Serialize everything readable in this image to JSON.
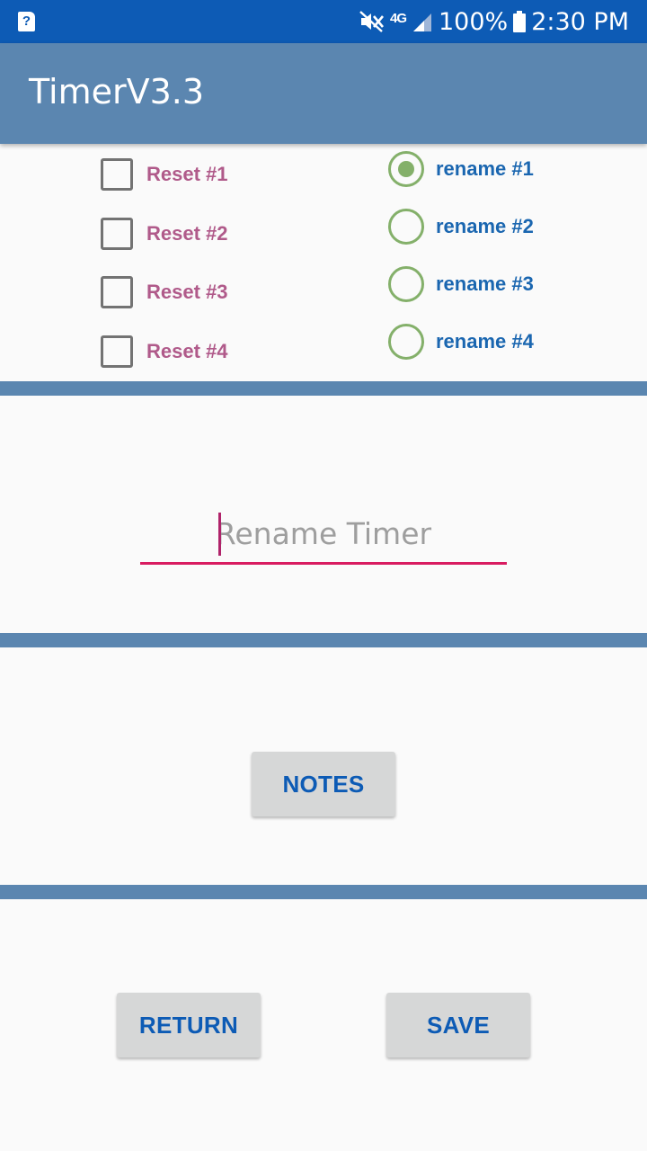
{
  "status_bar": {
    "network": "4G",
    "battery": "100%",
    "time": "2:30 PM"
  },
  "app_bar": {
    "title": "TimerV3.3"
  },
  "reset_checkboxes": [
    {
      "label": "Reset #1",
      "checked": false
    },
    {
      "label": "Reset #2",
      "checked": false
    },
    {
      "label": "Reset #3",
      "checked": false
    },
    {
      "label": "Reset #4",
      "checked": false
    }
  ],
  "rename_radios": [
    {
      "label": "rename #1",
      "selected": true
    },
    {
      "label": "rename #2",
      "selected": false
    },
    {
      "label": "rename #3",
      "selected": false
    },
    {
      "label": "rename #4",
      "selected": false
    }
  ],
  "rename_field": {
    "value": "",
    "placeholder": "Rename Timer"
  },
  "buttons": {
    "notes": "NOTES",
    "return": "RETURN",
    "save": "SAVE"
  },
  "colors": {
    "status_bar": "#0d5bb5",
    "app_bar": "#5b86b0",
    "checkbox_label": "#b05a8a",
    "radio_accent": "#84b06a",
    "radio_label": "#1a66b0",
    "field_underline": "#d81b60",
    "button_text": "#0d5bb5",
    "button_bg": "#d6d7d7"
  }
}
